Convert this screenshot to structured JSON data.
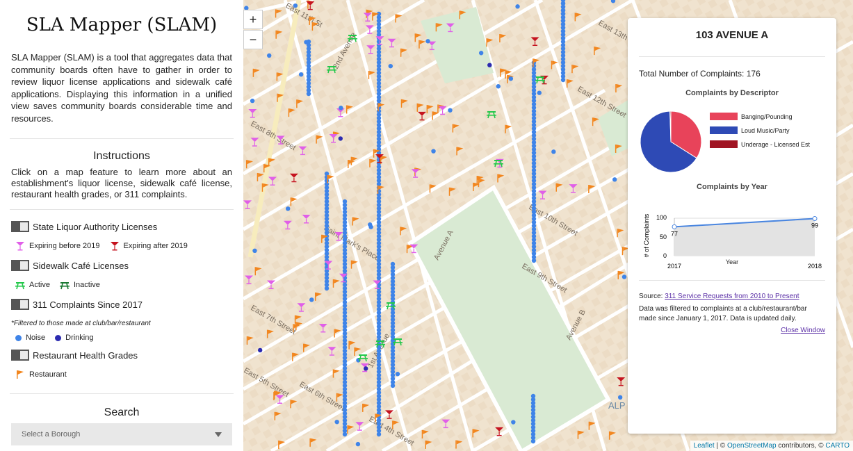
{
  "sidebar": {
    "title": "SLA Mapper (SLAM)",
    "description": "SLA Mapper (SLAM) is a tool that aggregates data that community boards often have to gather in order to review liquor license applications and sidewalk café applications. Displaying this information in a unified view saves community boards considerable time and resources.",
    "instructions_heading": "Instructions",
    "instructions_text": "Click on a map feature to learn more about an establishment's liquor license, sidewalk café license, restaurant health grades, or 311 complaints.",
    "layers": [
      {
        "label": "State Liquor Authority Licenses",
        "legend": [
          "Expiring before 2019",
          "Expiring after 2019"
        ]
      },
      {
        "label": "Sidewalk Café Licenses",
        "legend": [
          "Active",
          "Inactive"
        ]
      },
      {
        "label": "311 Complaints Since 2017",
        "note": "*Filtered to those made at club/bar/restaurant",
        "legend": [
          "Noise",
          "Drinking"
        ]
      },
      {
        "label": "Restaurant Health Grades",
        "legend": [
          "Restaurant"
        ]
      }
    ],
    "search_heading": "Search",
    "borough_placeholder": "Select a Borough"
  },
  "map": {
    "zoom_in": "+",
    "zoom_out": "−",
    "street_labels": [
      "East 10th Street",
      "East 9th Street",
      "East 7th Street",
      "Saint Mark's Place",
      "East 12th Street",
      "East 13th Street",
      "East 11th St",
      "East 5th Street",
      "East 6th Street",
      "East 4th Street",
      "East 8th Street",
      "Avenue A",
      "Avenue B",
      "2nd Avenue",
      "1st Avenue",
      "ALP"
    ],
    "attribution": {
      "leaflet": "Leaflet",
      "osm": "OpenStreetMap",
      "contrib": "contributors, ©",
      "carto": "CARTO",
      "copy": "| ©"
    }
  },
  "popup": {
    "title": "103 AVENUE A",
    "total_label": "Total Number of Complaints: 176",
    "pie_title": "Complaints by Descriptor",
    "pie_legend": [
      "Banging/Pounding",
      "Loud Music/Party",
      "Underage - Licensed Est"
    ],
    "year_title": "Complaints by Year",
    "y_axis_label": "# of Complaints",
    "x_axis_label": "Year",
    "y_ticks": [
      "100",
      "50",
      "0"
    ],
    "x_ticks": [
      "2017",
      "2018"
    ],
    "point_labels": [
      "77",
      "99"
    ],
    "source_prefix": "Source:",
    "source_link": "311 Service Requests from 2010 to Present",
    "note": "Data was filtered to complaints at a club/restaurant/bar made since January 1, 2017. Data is updated daily.",
    "close": "Close Window"
  },
  "chart_data": [
    {
      "type": "pie",
      "title": "Complaints by Descriptor",
      "categories": [
        "Banging/Pounding",
        "Loud Music/Party",
        "Underage - Licensed Est"
      ],
      "values": [
        0.34,
        0.655,
        0.005
      ],
      "colors": [
        "#e8435a",
        "#2e4ab5",
        "#a01423"
      ]
    },
    {
      "type": "line",
      "title": "Complaints by Year",
      "x": [
        2017,
        2018
      ],
      "values": [
        77,
        99
      ],
      "xlabel": "Year",
      "ylabel": "# of Complaints",
      "ylim": [
        0,
        100
      ],
      "color": "#4a86e0"
    }
  ],
  "colors": {
    "license_before": "#e05fe8",
    "license_after": "#c5131f",
    "cafe_active": "#23c84a",
    "cafe_inactive": "#1a7a33",
    "noise": "#3f84e8",
    "drinking": "#2c2bb0",
    "restaurant": "#f2861e"
  }
}
